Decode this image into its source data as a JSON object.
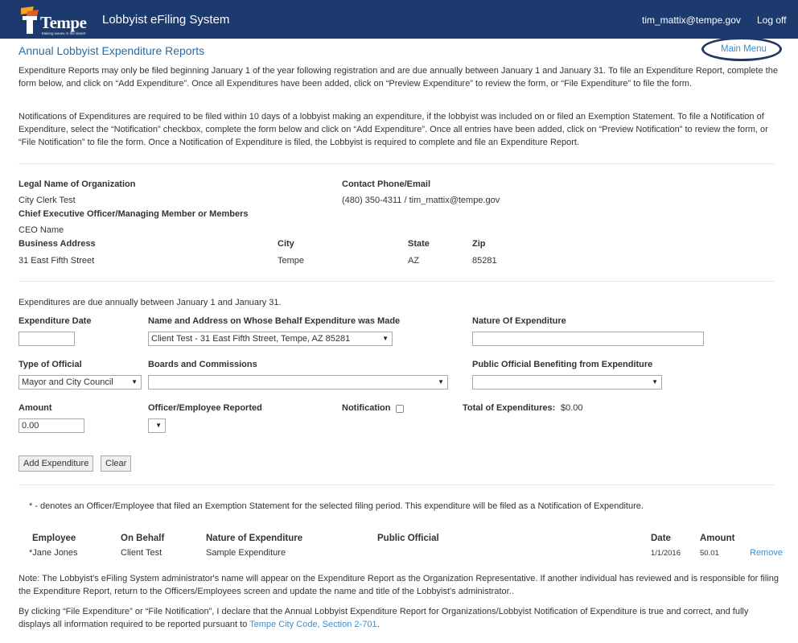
{
  "header": {
    "logo_text": "Tempe",
    "logo_tagline": "Making waves in the desert",
    "app_title": "Lobbyist eFiling System",
    "user": "tim_mattix@tempe.gov",
    "logoff": "Log off"
  },
  "page": {
    "title": "Annual Lobbyist Expenditure Reports",
    "main_menu": "Main Menu"
  },
  "intro": {
    "p1": "Expenditure Reports may only be filed beginning January 1 of the year following registration and are due annually between January 1 and January 31. To file an Expenditure Report, complete the form below, and click on “Add Expenditure”. Once all Expenditures have been added, click on “Preview Expenditure” to review the form, or “File Expenditure” to file the form.",
    "p2": "Notifications of Expenditures are required to be filed within 10 days of a lobbyist making an expenditure, if the lobbyist was included on or filed an Exemption Statement. To file a Notification of Expenditure, select the “Notification” checkbox, complete the form below and click on “Add Expenditure”. Once all entries have been added, click on “Preview Notification” to review the form, or “File Notification” to file the form. Once a Notification of Expenditure is filed, the Lobbyist is required to complete and file an Expenditure Report."
  },
  "org": {
    "legal_name_label": "Legal Name of Organization",
    "legal_name": "City Clerk Test",
    "contact_label": "Contact Phone/Email",
    "contact": "(480) 350-4311 / tim_mattix@tempe.gov",
    "ceo_label": "Chief Executive Officer/Managing Member or Members",
    "ceo": "CEO Name",
    "address_label": "Business Address",
    "address": "31 East Fifth Street",
    "city_label": "City",
    "city": "Tempe",
    "state_label": "State",
    "state": "AZ",
    "zip_label": "Zip",
    "zip": "85281"
  },
  "form": {
    "due_note": "Expenditures are due annually between January 1 and January 31.",
    "date_label": "Expenditure Date",
    "date_value": "",
    "behalf_label": "Name and Address on Whose Behalf Expenditure was Made",
    "behalf_value": "Client Test - 31 East Fifth Street, Tempe, AZ 85281",
    "nature_label": "Nature Of Expenditure",
    "nature_value": "",
    "official_type_label": "Type of Official",
    "official_type_value": "Mayor and City Council",
    "boards_label": "Boards and Commissions",
    "boards_value": "",
    "public_official_label": "Public Official Benefiting from Expenditure",
    "public_official_value": "",
    "amount_label": "Amount",
    "amount_value": "0.00",
    "officer_label": "Officer/Employee Reported",
    "officer_value": "",
    "notification_label": "Notification",
    "total_label": "Total of Expenditures:",
    "total_value": "$0.00",
    "add_button": "Add Expenditure",
    "clear_button": "Clear"
  },
  "exemption_note": "* - denotes an Officer/Employee that filed an Exemption Statement for the selected filing period. This expenditure will be filed as a Notification of Expenditure.",
  "table": {
    "headers": {
      "employee": "Employee",
      "on_behalf": "On Behalf",
      "nature": "Nature of Expenditure",
      "public_official": "Public Official",
      "date": "Date",
      "amount": "Amount"
    },
    "rows": [
      {
        "employee": "*Jane Jones",
        "on_behalf": "Client Test",
        "nature": "Sample Expenditure",
        "public_official": "",
        "date": "1/1/2016",
        "amount": "50.01",
        "action": "Remove"
      }
    ]
  },
  "footer": {
    "note": "Note: The Lobbyist's eFiling System administrator's name will appear on the Expenditure Report as the Organization Representative. If another individual has reviewed and is responsible for filing the Expenditure Report, return to the Officers/Employees screen and update the name and title of the Lobbyist's administrator..",
    "declare_text": "By clicking “File Expenditure” or “File Notification”, I declare that the Annual Lobbyist Expenditure Report for Organizations/Lobbyist Notification of Expenditure is true and correct, and fully displays all information required to be reported pursuant to ",
    "code_link": "Tempe City Code, Section 2-701",
    "period": "."
  },
  "colors": {
    "header_bg": "#1d3a6e",
    "link": "#3c8dd0",
    "title": "#2c6aa0",
    "highlight_oval": "#1f3864"
  },
  "icons": {
    "logo": "tempe-logo-icon",
    "dropdown": "chevron-down-icon"
  }
}
